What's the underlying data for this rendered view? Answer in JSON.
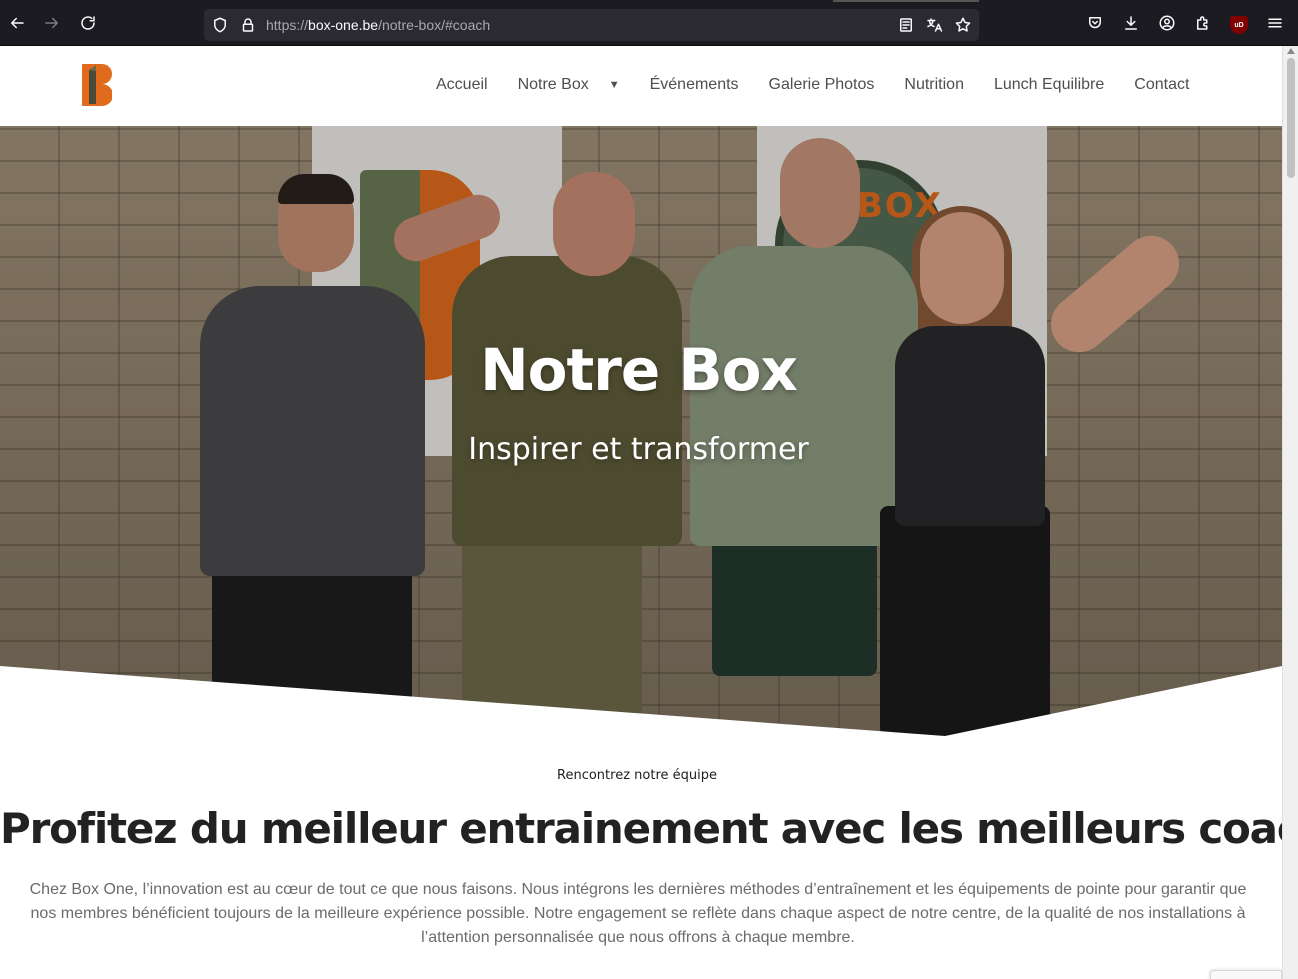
{
  "browser": {
    "url_scheme": "https://",
    "url_host": "box-one.be",
    "url_path": "/notre-box/#coach",
    "ublock_badge": "uD"
  },
  "site": {
    "nav": [
      {
        "label": "Accueil"
      },
      {
        "label": "Notre Box",
        "has_dropdown": true,
        "caret": "▼"
      },
      {
        "label": "Événements"
      },
      {
        "label": "Galerie Photos"
      },
      {
        "label": "Nutrition"
      },
      {
        "label": "Lunch Equilibre"
      },
      {
        "label": "Contact"
      }
    ],
    "logo_colors": {
      "primary": "#e06b1d",
      "secondary": "#4a4a3a"
    }
  },
  "hero": {
    "title": "Notre Box",
    "subtitle": "Inspirer et transformer",
    "banner_text": "BOX"
  },
  "section": {
    "eyebrow": "Rencontrez notre équipe",
    "title": "Profitez du meilleur entrainement avec les meilleurs coachs !",
    "body": "Chez Box One, l’innovation est au cœur de tout ce que nous faisons. Nous intégrons les dernières méthodes d’entraînement et les équipements de pointe pour garantir que nos membres bénéficient toujours de la meilleure expérience possible. Notre engagement se reflète dans chaque aspect de notre centre, de la qualité de nos installations à l’attention personnalisée que nous offrons à chaque membre."
  },
  "colors": {
    "accent": "#e06b1d",
    "heading": "#222222",
    "body_text": "#6b6b6b",
    "nav_text": "#4f4f4f"
  }
}
